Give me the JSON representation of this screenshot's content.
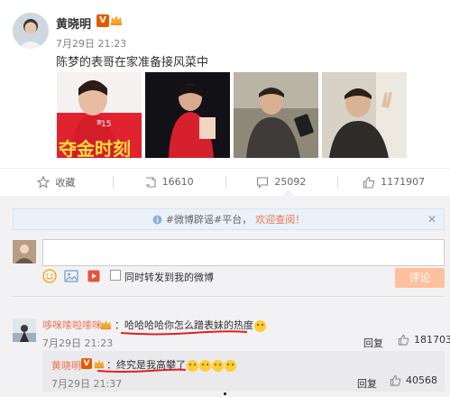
{
  "post": {
    "username": "黄晓明",
    "verified_badge": "V",
    "timestamp": "7月29日 21:23",
    "content": "陈梦的表哥在家准备接风菜中",
    "photos": [
      {
        "icon": "photo-athlete-poster",
        "poster_number": "15",
        "poster_text": "夺金时刻"
      },
      {
        "icon": "photo-athlete-dark"
      },
      {
        "icon": "photo-man-phone"
      },
      {
        "icon": "photo-man-car-peace"
      }
    ]
  },
  "actions": {
    "favorite_label": "收藏",
    "repost_count": "16610",
    "comment_count": "25092",
    "like_count": "1171907"
  },
  "notice": {
    "prefix": "#微博辟谣#平台，",
    "link": "欢迎查阅！",
    "close": "✕"
  },
  "composer": {
    "placeholder": "",
    "also_repost_label": "同时转发到我的微博",
    "submit_label": "评论"
  },
  "comments": [
    {
      "user": "哆咪嗦啦嗦咪",
      "text": "：哈哈哈哈你怎么蹭表妹的热度",
      "time": "7月29日 21:23",
      "reply_label": "回复",
      "likes": "181703"
    }
  ],
  "reply": {
    "user": "黄晓明",
    "badge": "V",
    "text": "：终究是我高攀了",
    "time": "7月29日 21:37",
    "reply_label": "回复",
    "likes": "40568"
  },
  "colors": {
    "accent": "#eb7350",
    "verified": "#e55a00",
    "underline": "#e02020",
    "submit_disabled": "#ffc09f"
  }
}
